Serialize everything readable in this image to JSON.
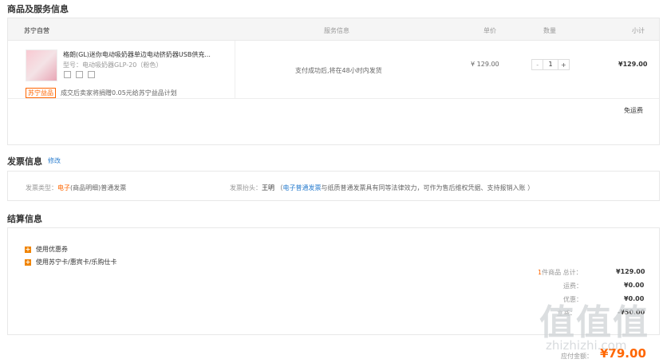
{
  "sections": {
    "goods_title": "商品及服务信息",
    "invoice_title": "发票信息",
    "invoice_edit": "修改",
    "settle_title": "结算信息"
  },
  "table": {
    "seller": "苏宁自营",
    "headers": {
      "service": "服务信息",
      "price": "单价",
      "qty": "数量",
      "subtotal": "小计"
    }
  },
  "item": {
    "name": "格朗(GL)迷你电动吸奶器单边电动挤奶器USB供充...",
    "model": "型号：电动吸奶器GLP-20（粉色）",
    "service_note": "支付成功后,将在48小时内发货",
    "price": "¥ 129.00",
    "qty_minus": "-",
    "qty": "1",
    "qty_plus": "+",
    "subtotal": "¥129.00",
    "badge": "苏宁益品",
    "charity": "成交后卖家将捐赠0.05元给苏宁益品计划"
  },
  "shipping": "免运费",
  "invoice": {
    "type_label": "发票类型：",
    "type_value_highlight": "电子",
    "type_value_rest": "(商品明细)普通发票",
    "header_label": "发票抬头：",
    "header_value": "王明",
    "note_open": "（",
    "note_link": "电子普通发票",
    "note_rest": "与纸质普通发票具有同等法律效力，可作为售后维权凭据、支持报销入账 ）"
  },
  "settle": {
    "coupon": "使用优惠券",
    "card": "使用苏宁卡/惠宾卡/乐购仕卡",
    "count": "1",
    "count_suffix": "件商品 总计：",
    "total": "¥129.00",
    "freight_label": "运费：",
    "freight": "¥0.00",
    "discount_label": "优惠：",
    "discount": "¥0.00",
    "reduce_label": "立减：",
    "reduce": "-¥50.00",
    "pay_label": "应付金额：",
    "pay": "¥79.00"
  },
  "watermark": {
    "glyphs": "值值值",
    "url": "zhizhizhi.com"
  }
}
